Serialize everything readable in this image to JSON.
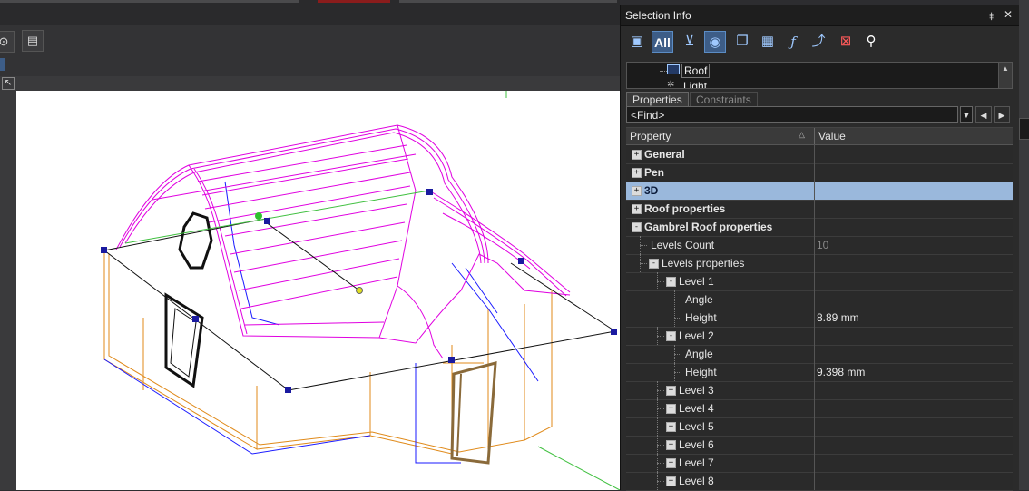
{
  "panel": {
    "title": "Selection Info",
    "pin_glyph": "⯒",
    "close_glyph": "✕",
    "toolbar": {
      "all_label": "All",
      "icons": [
        "properties-icon",
        "all-icon",
        "filter-icon",
        "visibility-icon",
        "copy-icon",
        "table-icon",
        "function-icon",
        "path-icon",
        "select-box-icon",
        "search-icon"
      ]
    },
    "tree": {
      "items": [
        {
          "label": "Roof"
        },
        {
          "label": "Light"
        }
      ]
    },
    "tabs": [
      {
        "label": "Properties",
        "active": true
      },
      {
        "label": "Constraints",
        "active": false
      }
    ],
    "find": {
      "value": "<Find>"
    },
    "grid": {
      "col_property": "Property",
      "col_value": "Value",
      "rows": [
        {
          "label": "General",
          "level": 0,
          "expander": "+",
          "bold": true,
          "value": ""
        },
        {
          "label": "Pen",
          "level": 0,
          "expander": "+",
          "bold": true,
          "value": ""
        },
        {
          "label": "3D",
          "level": 0,
          "expander": "+",
          "bold": true,
          "value": "",
          "selected": true
        },
        {
          "label": "Roof properties",
          "level": 0,
          "expander": "+",
          "bold": true,
          "value": ""
        },
        {
          "label": "Gambrel Roof properties",
          "level": 0,
          "expander": "-",
          "bold": true,
          "value": ""
        },
        {
          "label": "Levels Count",
          "level": 1,
          "expander": "",
          "bold": false,
          "value": "10",
          "dim": true
        },
        {
          "label": "Levels properties",
          "level": 1,
          "expander": "-",
          "bold": false,
          "value": ""
        },
        {
          "label": "Level 1",
          "level": 2,
          "expander": "-",
          "bold": false,
          "value": ""
        },
        {
          "label": "Angle",
          "level": 3,
          "expander": "",
          "bold": false,
          "value": ""
        },
        {
          "label": "Height",
          "level": 3,
          "expander": "",
          "bold": false,
          "value": "8.89 mm"
        },
        {
          "label": "Level 2",
          "level": 2,
          "expander": "-",
          "bold": false,
          "value": ""
        },
        {
          "label": "Angle",
          "level": 3,
          "expander": "",
          "bold": false,
          "value": ""
        },
        {
          "label": "Height",
          "level": 3,
          "expander": "",
          "bold": false,
          "value": "9.398 mm"
        },
        {
          "label": "Level 3",
          "level": 2,
          "expander": "+",
          "bold": false,
          "value": ""
        },
        {
          "label": "Level 4",
          "level": 2,
          "expander": "+",
          "bold": false,
          "value": ""
        },
        {
          "label": "Level 5",
          "level": 2,
          "expander": "+",
          "bold": false,
          "value": ""
        },
        {
          "label": "Level 6",
          "level": 2,
          "expander": "+",
          "bold": false,
          "value": ""
        },
        {
          "label": "Level 7",
          "level": 2,
          "expander": "+",
          "bold": false,
          "value": ""
        },
        {
          "label": "Level 8",
          "level": 2,
          "expander": "+",
          "bold": false,
          "value": ""
        }
      ]
    }
  },
  "colors": {
    "accent": "#3d5d87",
    "selected_row": "#9ab8dc",
    "roof_wire": "#e000e0",
    "wall_wire": "#e08a1a",
    "edge_wire": "#1a1aff"
  }
}
